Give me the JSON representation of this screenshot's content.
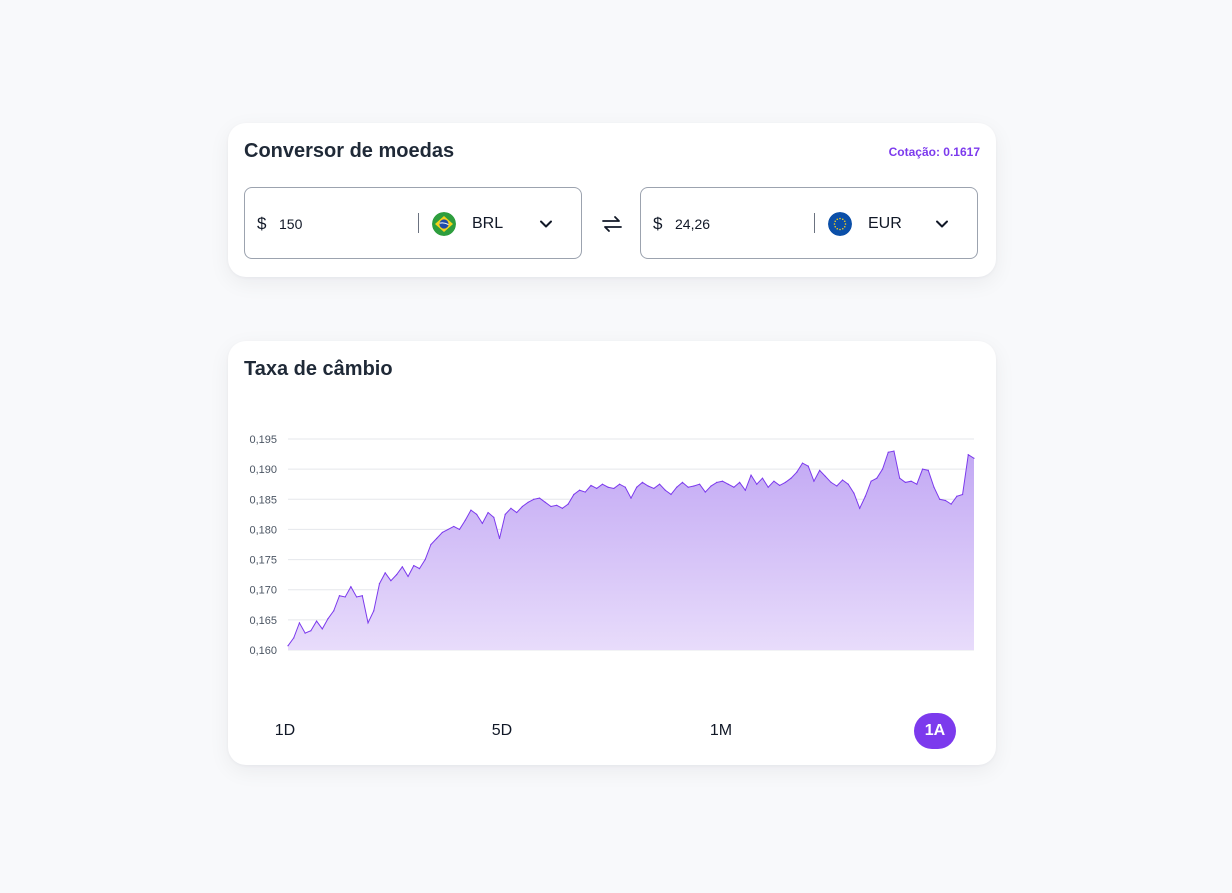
{
  "converter": {
    "title": "Conversor de moedas",
    "quote_label": "Cotação: 0.1617",
    "from": {
      "symbol": "$",
      "amount": "150",
      "currency": "BRL",
      "flag_icon": "brazil-flag-icon"
    },
    "to": {
      "symbol": "$",
      "amount": "24,26",
      "currency": "EUR",
      "flag_icon": "eu-flag-icon"
    },
    "swap_icon": "swap-arrows-icon"
  },
  "rate": {
    "title": "Taxa de câmbio",
    "ranges": [
      "1D",
      "5D",
      "1M",
      "1A"
    ],
    "active_range": "1A"
  },
  "colors": {
    "accent": "#7c3aed",
    "area_top": "#c2a8f4",
    "area_bottom": "#e8dcfb",
    "line": "#7c3aed"
  },
  "chart_data": {
    "type": "area",
    "title": "",
    "xlabel": "",
    "ylabel": "",
    "ylim": [
      0.16,
      0.195
    ],
    "yticks": [
      "0,195",
      "0,190",
      "0,185",
      "0,180",
      "0,175",
      "0,170",
      "0,165",
      "0,160"
    ],
    "ytick_values": [
      0.195,
      0.19,
      0.185,
      0.18,
      0.175,
      0.17,
      0.165,
      0.16
    ],
    "grid": true,
    "x": [
      0,
      1,
      2,
      3,
      4,
      5,
      6,
      7,
      8,
      9,
      10,
      11,
      12,
      13,
      14,
      15,
      16,
      17,
      18,
      19,
      20,
      21,
      22,
      23,
      24,
      25,
      26,
      27,
      28,
      29,
      30,
      31,
      32,
      33,
      34,
      35,
      36,
      37,
      38,
      39,
      40,
      41,
      42,
      43,
      44,
      45,
      46,
      47,
      48,
      49,
      50,
      51,
      52,
      53,
      54,
      55,
      56,
      57,
      58,
      59,
      60,
      61,
      62,
      63,
      64,
      65,
      66,
      67,
      68,
      69,
      70,
      71,
      72,
      73,
      74,
      75,
      76,
      77,
      78,
      79,
      80,
      81,
      82,
      83,
      84,
      85,
      86,
      87,
      88,
      89,
      90,
      91,
      92,
      93,
      94,
      95,
      96,
      97,
      98,
      99,
      100,
      101,
      102,
      103,
      104,
      105,
      106,
      107,
      108,
      109,
      110,
      111,
      112,
      113,
      114,
      115,
      116,
      117,
      118,
      119,
      120
    ],
    "values": [
      0.1607,
      0.162,
      0.1645,
      0.1628,
      0.1632,
      0.1648,
      0.1635,
      0.1652,
      0.1665,
      0.169,
      0.1688,
      0.1705,
      0.1688,
      0.169,
      0.1645,
      0.1665,
      0.171,
      0.1728,
      0.1715,
      0.1725,
      0.1738,
      0.1722,
      0.174,
      0.1735,
      0.175,
      0.1775,
      0.1785,
      0.1795,
      0.18,
      0.1805,
      0.18,
      0.1815,
      0.1832,
      0.1825,
      0.181,
      0.1828,
      0.182,
      0.1785,
      0.1825,
      0.1835,
      0.1828,
      0.1838,
      0.1845,
      0.185,
      0.1852,
      0.1845,
      0.1838,
      0.184,
      0.1835,
      0.1842,
      0.1858,
      0.1865,
      0.1862,
      0.1873,
      0.1868,
      0.1875,
      0.187,
      0.1868,
      0.1875,
      0.187,
      0.1852,
      0.187,
      0.1878,
      0.1872,
      0.1868,
      0.1875,
      0.1865,
      0.1858,
      0.187,
      0.1878,
      0.187,
      0.1872,
      0.1875,
      0.1862,
      0.1872,
      0.1878,
      0.188,
      0.1875,
      0.187,
      0.1878,
      0.1865,
      0.189,
      0.1875,
      0.1885,
      0.187,
      0.188,
      0.1873,
      0.1878,
      0.1885,
      0.1895,
      0.191,
      0.1905,
      0.188,
      0.1898,
      0.1888,
      0.1878,
      0.1872,
      0.1882,
      0.1875,
      0.186,
      0.1835,
      0.1855,
      0.188,
      0.1885,
      0.19,
      0.1928,
      0.193,
      0.1885,
      0.1878,
      0.188,
      0.1875,
      0.19,
      0.1898,
      0.187,
      0.185,
      0.1848,
      0.1842,
      0.1855,
      0.1858,
      0.1924,
      0.1918
    ]
  }
}
